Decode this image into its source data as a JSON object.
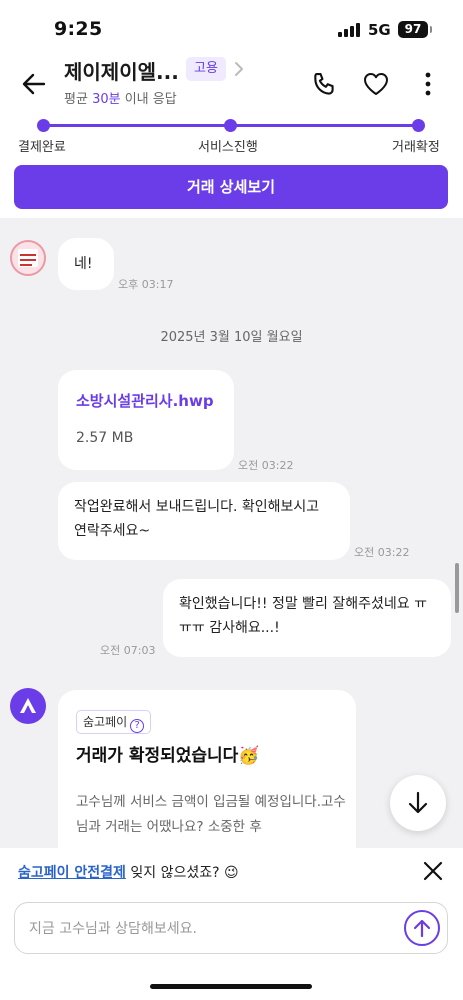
{
  "status_bar": {
    "time": "9:25",
    "network": "5G",
    "battery": "97"
  },
  "header": {
    "title": "제이제이엘...",
    "badge": "고용",
    "response_prefix": "평균",
    "response_time": "30분",
    "response_suffix": "이내 응답"
  },
  "progress": {
    "steps": [
      "결제완료",
      "서비스진행",
      "거래확정"
    ],
    "completed_steps": 3
  },
  "detail_button": "거래 상세보기",
  "chat": {
    "messages": [
      {
        "text": "네!",
        "time": "오후 03:17"
      }
    ],
    "date_separator": "2025년 3월 10일 월요일",
    "file": {
      "name": "소방시설관리사.hwp",
      "size": "2.57 MB",
      "time": "오전 03:22"
    },
    "completion_message": {
      "text": "작업완료해서 보내드립니다. 확인해보시고 연락주세요~",
      "time": "오전 03:22"
    },
    "my_message": {
      "text": "확인했습니다!! 정말 빨리 잘해주셨네요 ㅠㅠㅠ 감사해요...!",
      "time": "오전 07:03"
    },
    "pay_card": {
      "badge": "숨고페이",
      "badge_help": "?",
      "title": "거래가 확정되었습니다🥳",
      "body": "고수님께 서비스 금액이 입금될 예정입니다.고수님과 거래는 어땠나요? 소중한 후"
    }
  },
  "notice": {
    "link_text": "숨고페이 안전결제",
    "suffix": "잊지 않으셨죠? 😉"
  },
  "composer": {
    "placeholder": "지금 고수님과 상담해보세요."
  },
  "colors": {
    "accent": "#6a3de8",
    "link": "#2a63c9",
    "chat_bg": "#f1f1f3"
  }
}
